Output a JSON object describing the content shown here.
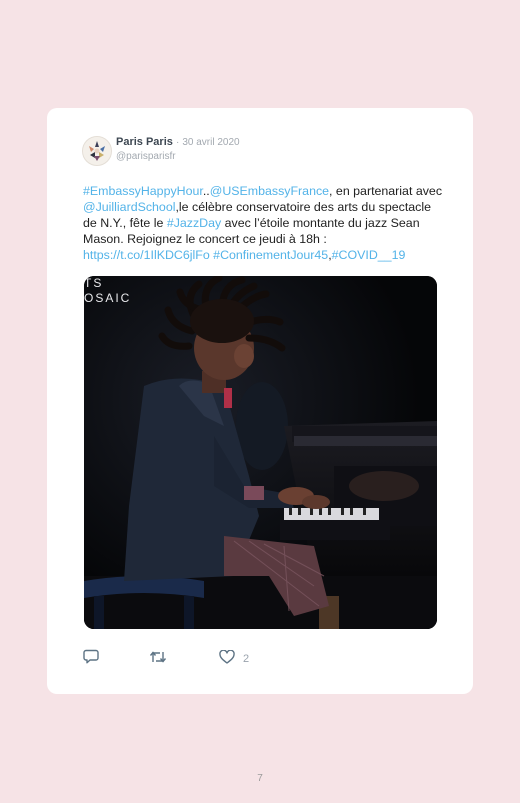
{
  "tweet": {
    "author_name": "Paris Paris",
    "separator": "·",
    "date": "30 avril 2020",
    "handle": "@parisparisfr",
    "segments": [
      {
        "text": "#EmbassyHappyHour",
        "link": true
      },
      {
        "text": "..",
        "link": false
      },
      {
        "text": "@USEmbassyFrance",
        "link": true
      },
      {
        "text": ", en partenariat avec ",
        "link": false
      },
      {
        "text": "@JuilliardSchool",
        "link": true
      },
      {
        "text": ",le célèbre conservatoire des arts du spectacle de N.Y., fête le ",
        "link": false
      },
      {
        "text": "#JazzDay",
        "link": true
      },
      {
        "text": " avec l’étoile montante du jazz Sean Mason. Rejoignez le concert ce jeudi à 18h : ",
        "link": false
      },
      {
        "text": "https://t.co/1IlKDC6jlFo",
        "link": true
      },
      {
        "text": " ",
        "link": false
      },
      {
        "text": "#ConfinementJour45",
        "link": true
      },
      {
        "text": ",",
        "link": false
      },
      {
        "text": "#COVID__19",
        "link": true
      }
    ],
    "media_overlay": [
      "TS",
      "OSAIC"
    ],
    "actions": {
      "reply_count": "",
      "retweet_count": "",
      "like_count": "2"
    }
  },
  "page_number": "7",
  "colors": {
    "page_background": "#f6e3e6",
    "link": "#53b3e8",
    "icon": "#5d7384"
  },
  "icons": [
    "avatar",
    "reply-icon",
    "retweet-icon",
    "heart-icon"
  ]
}
